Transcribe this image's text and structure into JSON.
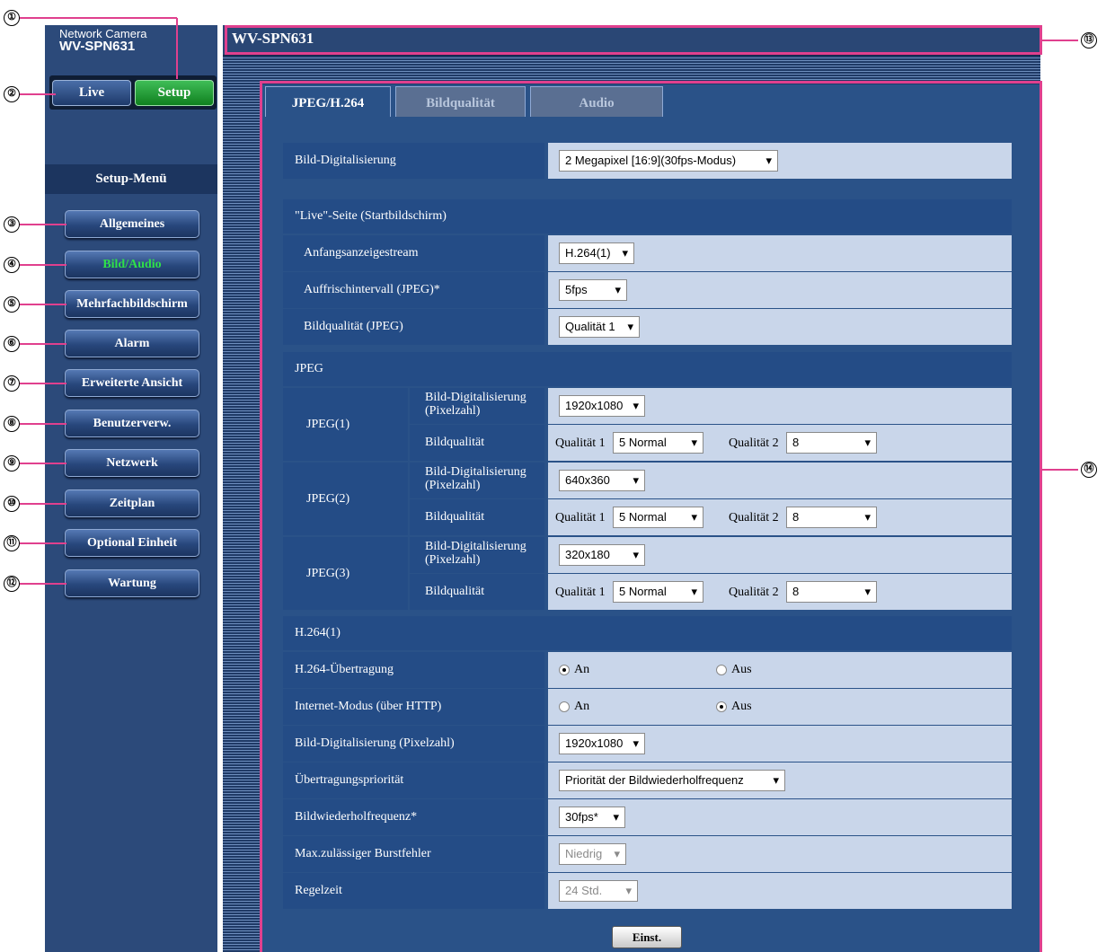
{
  "brand": {
    "line1": "Network Camera",
    "line2": "WV-SPN631"
  },
  "top_buttons": {
    "live": "Live",
    "setup": "Setup"
  },
  "menu": {
    "title": "Setup-Menü",
    "items": [
      "Allgemeines",
      "Bild/Audio",
      "Mehrfachbildschirm",
      "Alarm",
      "Erweiterte Ansicht",
      "Benutzerverw.",
      "Netzwerk",
      "Zeitplan",
      "Optional Einheit",
      "Wartung"
    ],
    "active": "Bild/Audio"
  },
  "header": {
    "title": "WV-SPN631"
  },
  "tabs": [
    "JPEG/H.264",
    "Bildqualität",
    "Audio"
  ],
  "form": {
    "capture": {
      "label": "Bild-Digitalisierung",
      "value": "2 Megapixel [16:9](30fps-Modus)"
    },
    "live_section": "\"Live\"-Seite (Startbildschirm)",
    "initial_stream": {
      "label": "Anfangsanzeigestream",
      "value": "H.264(1)"
    },
    "refresh": {
      "label": "Auffrischintervall (JPEG)*",
      "value": "5fps"
    },
    "quality_jpeg": {
      "label": "Bildqualität (JPEG)",
      "value": "Qualität 1"
    },
    "jpeg_section": "JPEG",
    "capture_label": "Bild-Digitalisierung",
    "pixel_label": "(Pixelzahl)",
    "quality_label": "Bildqualität",
    "q1_label": "Qualität 1",
    "q2_label": "Qualität 2",
    "jpeg1": {
      "name": "JPEG(1)",
      "size": "1920x1080",
      "q1": "5 Normal",
      "q2": "8"
    },
    "jpeg2": {
      "name": "JPEG(2)",
      "size": "640x360",
      "q1": "5 Normal",
      "q2": "8"
    },
    "jpeg3": {
      "name": "JPEG(3)",
      "size": "320x180",
      "q1": "5 Normal",
      "q2": "8"
    },
    "h264_section": "H.264(1)",
    "h264_trans": {
      "label": "H.264-Übertragung",
      "on": "An",
      "off": "Aus",
      "selected": "An"
    },
    "internet_mode": {
      "label": "Internet-Modus (über HTTP)",
      "on": "An",
      "off": "Aus",
      "selected": "Aus"
    },
    "h264_size": {
      "label": "Bild-Digitalisierung (Pixelzahl)",
      "value": "1920x1080"
    },
    "priority": {
      "label": "Übertragungspriorität",
      "value": "Priorität der Bildwiederholfrequenz"
    },
    "framerate": {
      "label": "Bildwiederholfrequenz*",
      "value": "30fps*"
    },
    "burst": {
      "label": "Max.zulässiger Burstfehler",
      "value": "Niedrig"
    },
    "control": {
      "label": "Regelzeit",
      "value": "24 Std."
    }
  },
  "save_button": "Einst.",
  "callouts": [
    "①",
    "②",
    "③",
    "④",
    "⑤",
    "⑥",
    "⑦",
    "⑧",
    "⑨",
    "⑩",
    "⑪",
    "⑫",
    "⑬",
    "⑭"
  ],
  "colors": {
    "sidebar": "#2c4a7a",
    "active_text": "#2fe04a",
    "setup_button": "#1a9a32",
    "callout_frame": "#e0408e",
    "value_cell": "#c9d6ea"
  }
}
